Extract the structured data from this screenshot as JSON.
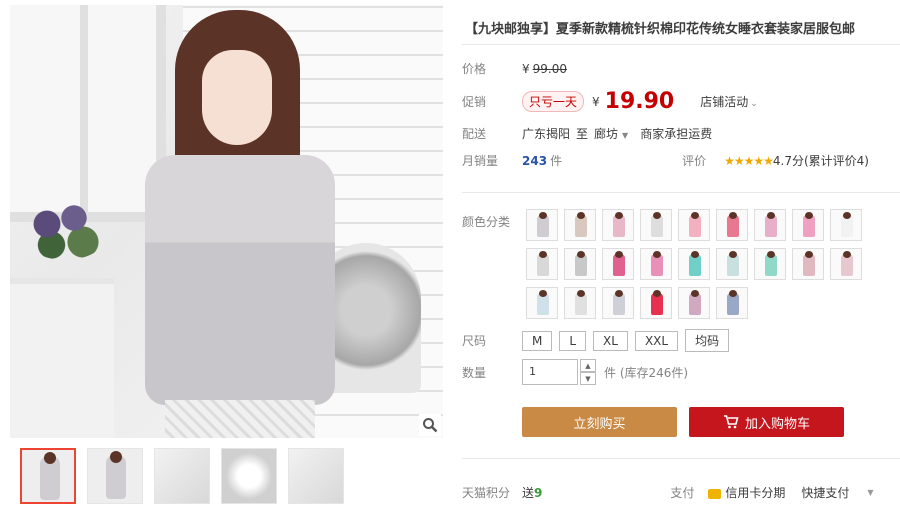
{
  "title": "【九块邮独享】夏季新款精梳针织棉印花传统女睡衣套装家居服包邮",
  "price": {
    "label": "价格",
    "currency": "¥",
    "original": "99.00"
  },
  "promo": {
    "label": "促销",
    "tag": "只亏一天",
    "currency": "¥",
    "price": "19.90",
    "shop_activity": "店铺活动"
  },
  "shipping": {
    "label": "配送",
    "from": "广东揭阳",
    "to_word": "至",
    "destination": "廊坊",
    "fee": "商家承担运费"
  },
  "sales": {
    "label": "月销量",
    "count": "243",
    "unit": "件",
    "rating_label": "评价",
    "stars": "★★★★★",
    "score": "4.7分",
    "review_text": "(累计评价4)"
  },
  "colors": {
    "label": "颜色分类",
    "swatches": [
      "#cfcdd2",
      "#d8c8c0",
      "#e8b8c8",
      "#ddd",
      "#f2b0c0",
      "#e87890",
      "#e8b0c8",
      "#f0a0c0",
      "#f2f2f2",
      "#d8d8d8",
      "#c8c8c8",
      "#e06090",
      "#e890b8",
      "#70d0c8",
      "#c8e0e0",
      "#90d8c8",
      "#e0b8c0",
      "#e8c8d0",
      "#d0e0e8",
      "#e0e0e0",
      "#cfcfd8",
      "#e83050",
      "#d0a8c0",
      "#9aa8c8"
    ]
  },
  "sizes": {
    "label": "尺码",
    "options": [
      "M",
      "L",
      "XL",
      "XXL",
      "均码"
    ]
  },
  "quantity": {
    "label": "数量",
    "value": "1",
    "stock_note": "件 (库存246件)"
  },
  "buttons": {
    "buy_now": "立刻购买",
    "add_to_cart": "加入购物车"
  },
  "footer": {
    "label": "天猫积分",
    "points_prefix": "送",
    "points": "9",
    "payment_label": "支付",
    "credit": "信用卡分期",
    "express": "快捷支付"
  },
  "colors_ui": {
    "price_red": "#c40000",
    "buy_btn": "#c98a45",
    "cart_btn": "#c4161c"
  }
}
